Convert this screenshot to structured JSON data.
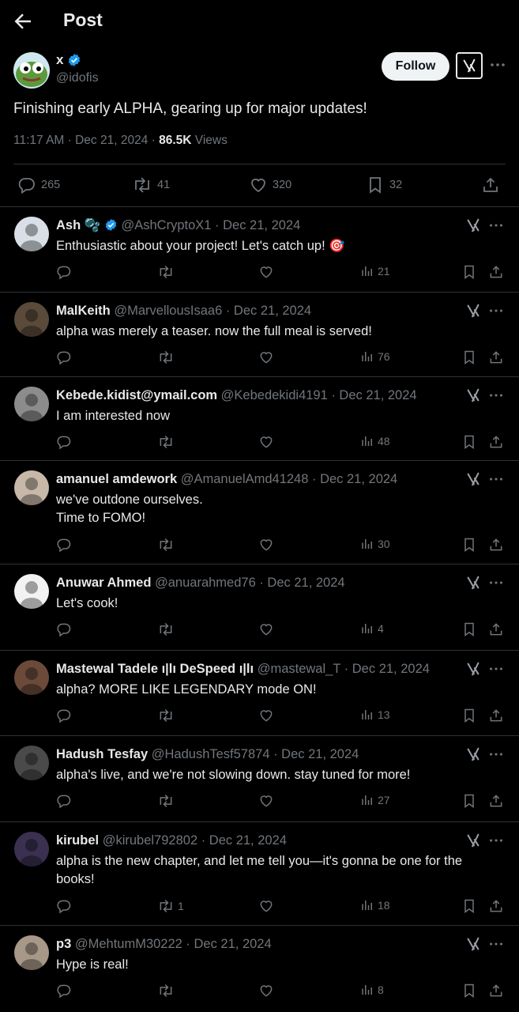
{
  "header": {
    "title": "Post"
  },
  "post": {
    "author_name": "x",
    "author_handle": "@idofis",
    "follow_label": "Follow",
    "text": "Finishing early ALPHA, gearing up for major updates!",
    "time": "11:17 AM · Dec 21, 2024 · ",
    "views_count": "86.5K",
    "views_label": " Views",
    "stats": {
      "replies": "265",
      "reposts": "41",
      "likes": "320",
      "bookmarks": "32"
    }
  },
  "replies": [
    {
      "name": "Ash 🫧",
      "verified": true,
      "handle": "@AshCryptoX1 · Dec 21, 2024",
      "text": "Enthusiastic about your project! Let's catch up! 🎯",
      "reposts": "",
      "views": "21"
    },
    {
      "name": "MalKeith",
      "verified": false,
      "handle": "@MarvellousIsaa6 · Dec 21, 2024",
      "text": "alpha was merely a teaser. now the full meal is served!",
      "reposts": "",
      "views": "76"
    },
    {
      "name": "Kebede.kidist@ymail.com",
      "verified": false,
      "handle": "@Kebedekidi4191 · Dec 21, 2024",
      "text": "I am interested now",
      "reposts": "",
      "views": "48"
    },
    {
      "name": "amanuel amdework",
      "verified": false,
      "handle": "@AmanuelAmd41248 · Dec 21, 2024",
      "text": "we've outdone ourselves.\nTime to FOMO!",
      "reposts": "",
      "views": "30"
    },
    {
      "name": "Anuwar Ahmed",
      "verified": false,
      "handle": "@anuarahmed76 · Dec 21, 2024",
      "text": "Let's cook!",
      "reposts": "",
      "views": "4"
    },
    {
      "name": "Mastewal Tadele ı|lı DeSpeed ı|lı",
      "verified": false,
      "handle": "@mastewal_T · Dec 21, 2024",
      "text": "alpha? MORE LIKE LEGENDARY mode ON!",
      "reposts": "",
      "views": "13"
    },
    {
      "name": "Hadush Tesfay",
      "verified": false,
      "handle": "@HadushTesf57874 · Dec 21, 2024",
      "text": "alpha's live, and we're not slowing down. stay tuned for more!",
      "reposts": "",
      "views": "27"
    },
    {
      "name": "kirubel",
      "verified": false,
      "handle": "@kirubel792802 · Dec 21, 2024",
      "text": "alpha is the new chapter, and let me tell you—it's gonna be one for the books!",
      "reposts": "1",
      "views": "18"
    },
    {
      "name": "p3",
      "verified": false,
      "handle": "@MehtumM30222 · Dec 21, 2024",
      "text": "Hype is real!",
      "reposts": "",
      "views": "8"
    }
  ],
  "colors": {
    "background": "#000000",
    "text": "#e7e9ea",
    "muted": "#71767b",
    "verified": "#1d9bf0",
    "divider": "#2f3336"
  }
}
